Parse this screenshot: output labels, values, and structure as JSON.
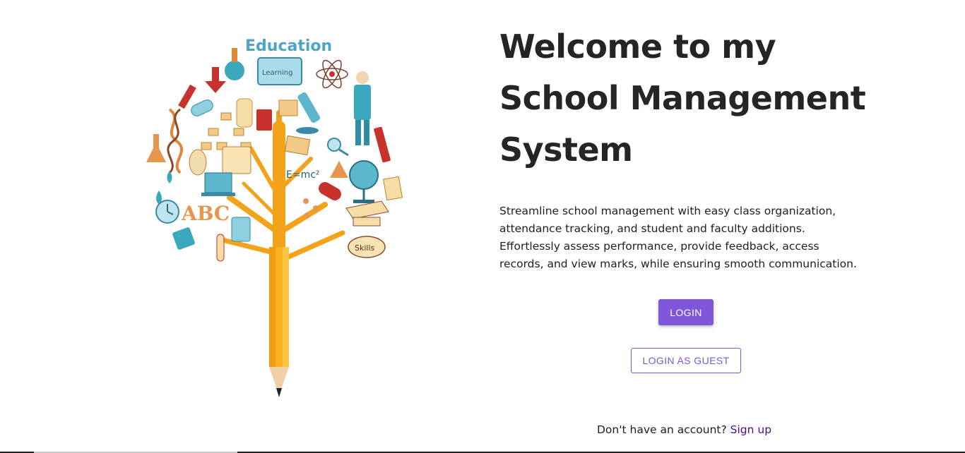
{
  "hero": {
    "title_lines": [
      "Welcome to my",
      "School Management",
      "System"
    ],
    "description": "Streamline school management with easy class organization, attendance tracking, and student and faculty additions. Effortlessly assess performance, provide feedback, access records, and view marks, while ensuring smooth communication."
  },
  "illustration": {
    "heading": "Education",
    "screen_text": "Learning",
    "formula": "E=mc²",
    "skills_label": "Skills",
    "letters": "ABC"
  },
  "actions": {
    "login_label": "LOGIN",
    "guest_label": "LOGIN AS GUEST"
  },
  "signup": {
    "prompt": "Don't have an account?",
    "link_label": "Sign up"
  },
  "colors": {
    "accent": "#7f56d9",
    "link": "#550a7a",
    "title": "#252525"
  }
}
